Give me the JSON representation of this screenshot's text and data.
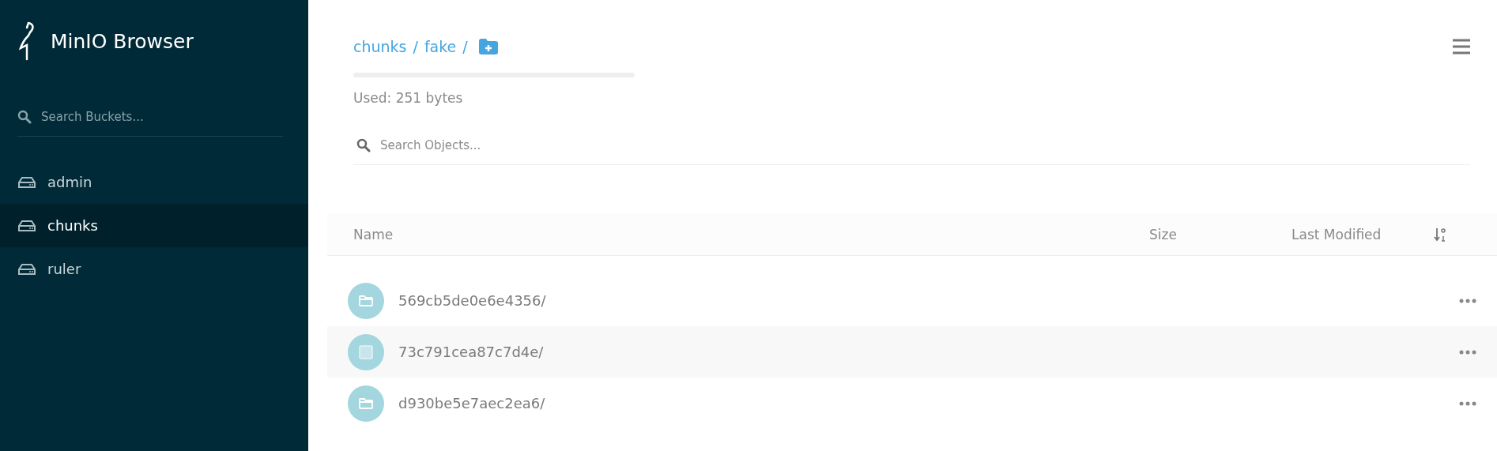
{
  "sidebar": {
    "title": "MinIO Browser",
    "search": {
      "placeholder": "Search Buckets..."
    },
    "buckets": [
      {
        "name": "admin",
        "selected": false
      },
      {
        "name": "chunks",
        "selected": true
      },
      {
        "name": "ruler",
        "selected": false
      }
    ]
  },
  "breadcrumb": [
    {
      "label": "chunks",
      "separator": "/"
    },
    {
      "label": "fake",
      "separator": "/"
    }
  ],
  "usage": {
    "text": "Used: 251 bytes"
  },
  "search": {
    "placeholder": "Search Objects..."
  },
  "table": {
    "columns": [
      "Name",
      "Size",
      "Last Modified"
    ],
    "rows": [
      {
        "name": "569cb5de0e6e4356/",
        "highlighted": false
      },
      {
        "name": "73c791cea87c7d4e/",
        "highlighted": true
      },
      {
        "name": "d930be5e7aec2ea6/",
        "highlighted": false
      }
    ]
  }
}
